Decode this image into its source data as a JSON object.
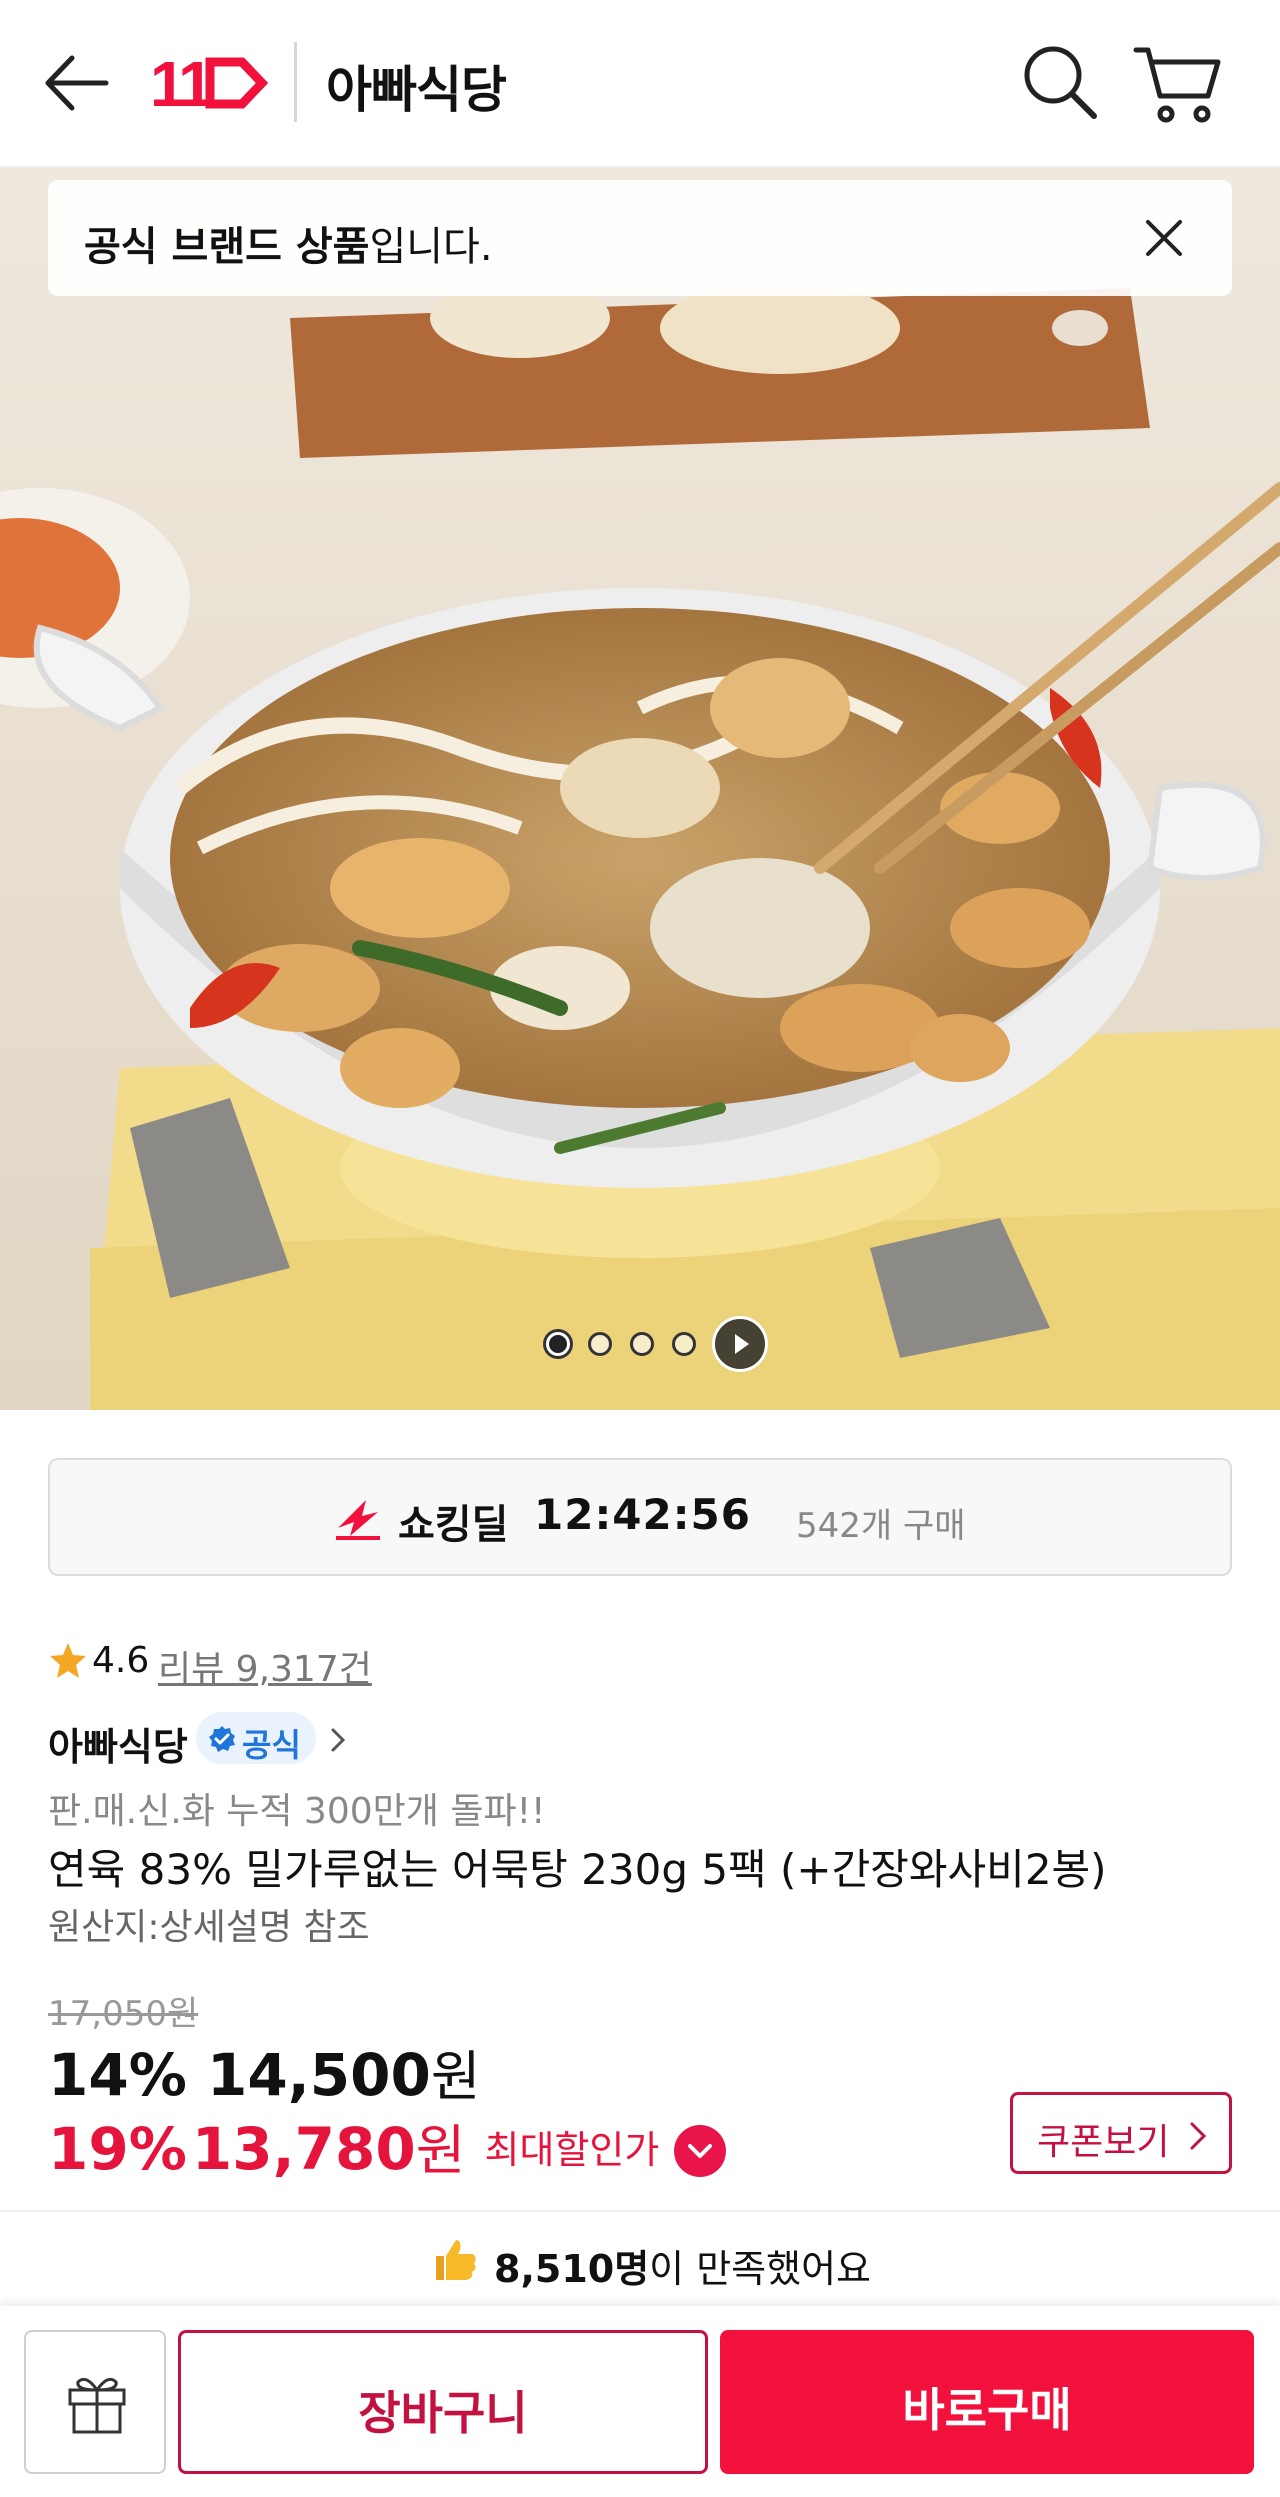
{
  "header": {
    "title": "아빠식당",
    "logo_text": "11",
    "icons": [
      "back-arrow-icon",
      "search-icon",
      "cart-icon"
    ],
    "brand_color": "#f2113d"
  },
  "toast": {
    "bold": "공식 브랜드 상품",
    "rest": "입니다."
  },
  "carousel": {
    "total_images": 4,
    "active_index": 0
  },
  "deal": {
    "label": "쇼킹딜",
    "timer": "12:42:56",
    "purchases": "542개 구매"
  },
  "rating": {
    "value": "4.6",
    "reviews": "리뷰 9,317건"
  },
  "seller": {
    "name": "아빠식당",
    "badge": "공식"
  },
  "product": {
    "promo": "판.매.신.화 누적 300만개 돌파!!",
    "title": "연육 83% 밀가루없는 어묵탕 230g 5팩 (+간장와사비2봉)",
    "origin": "원산지:상세설명 참조"
  },
  "price": {
    "original": "17,050원",
    "discount_pct": "14%",
    "discount_price": "14,500",
    "unit": "원",
    "max_pct": "19%",
    "max_price": "13,780",
    "max_label": "최대할인가",
    "coupon_label": "쿠폰보기"
  },
  "satisfaction": {
    "count": "8,510명",
    "text": "이 만족했어요"
  },
  "bottom": {
    "cart_label": "장바구니",
    "buy_label": "바로구매"
  }
}
